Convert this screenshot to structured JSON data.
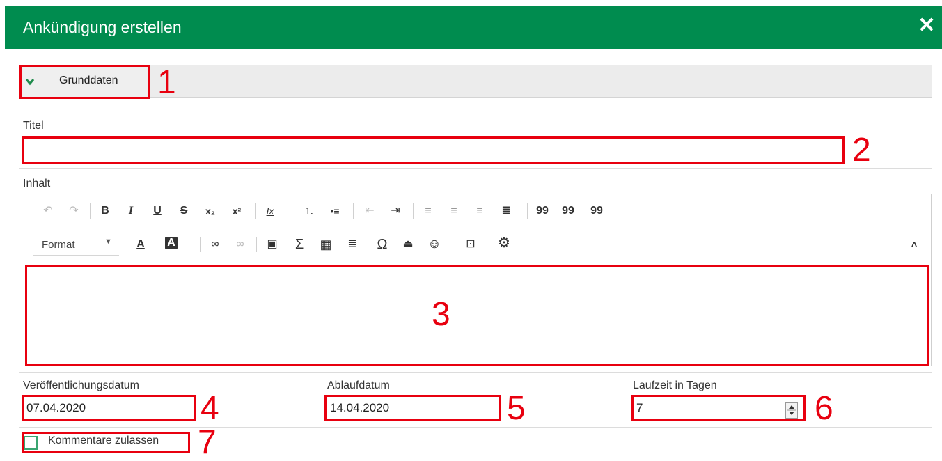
{
  "dialog": {
    "title": "Ankündigung erstellen",
    "close_icon": "close-icon"
  },
  "section": {
    "label": "Grunddaten",
    "icon": "chevron-down-icon"
  },
  "fields": {
    "title_label": "Titel",
    "title_value": "",
    "content_label": "Inhalt",
    "publish_label": "Veröffentlichungsdatum",
    "publish_value": "07.04.2020",
    "expiry_label": "Ablaufdatum",
    "expiry_value": "14.04.2020",
    "duration_label": "Laufzeit in Tagen",
    "duration_value": "7",
    "comments_label": "Kommentare zulassen"
  },
  "editor": {
    "format_label": "Format",
    "toolbar_row1": [
      "undo-icon",
      "redo-icon",
      "bold-icon",
      "italic-icon",
      "underline-icon",
      "strikethrough-icon",
      "subscript-icon",
      "superscript-icon",
      "remove-format-icon",
      "numbered-list-icon",
      "bulleted-list-icon",
      "outdent-icon",
      "indent-icon",
      "align-left-icon",
      "align-center-icon",
      "align-right-icon",
      "justify-icon",
      "blockquote-icon",
      "quote-variant-icon",
      "remove-quote-icon"
    ],
    "toolbar_row2": [
      "text-color-icon",
      "background-color-icon",
      "link-icon",
      "unlink-icon",
      "image-icon",
      "formula-icon",
      "table-icon",
      "horizontal-line-icon",
      "special-char-icon",
      "page-break-icon",
      "smiley-icon",
      "embed-icon",
      "settings-icon",
      "collapse-toolbar-icon"
    ],
    "glyphs": {
      "undo": "↶",
      "redo": "↷",
      "bold": "B",
      "italic": "I",
      "underline": "U",
      "strike": "S",
      "sub": "x₂",
      "sup": "x²",
      "clear": "Ix",
      "ol": "⒈",
      "ul": "•≡",
      "outdent": "⇤",
      "indent": "⇥",
      "left": "≡",
      "center": "≡",
      "right": "≡",
      "justify": "≣",
      "quote": "99",
      "quote2": "99",
      "quote3": "99",
      "textcolor": "A",
      "bgcolor": "A",
      "link": "∞",
      "unlink": "∞",
      "image": "▣",
      "sigma": "Σ",
      "table": "▦",
      "hr": "≣",
      "omega": "Ω",
      "pagebreak": "⏏",
      "smiley": "☺",
      "embed": "⊡",
      "gear": "⚙",
      "collapse": "^"
    }
  },
  "annotations": [
    "1",
    "2",
    "3",
    "4",
    "5",
    "6",
    "7"
  ],
  "colors": {
    "header": "#008c4f",
    "highlight": "#e8000f"
  }
}
